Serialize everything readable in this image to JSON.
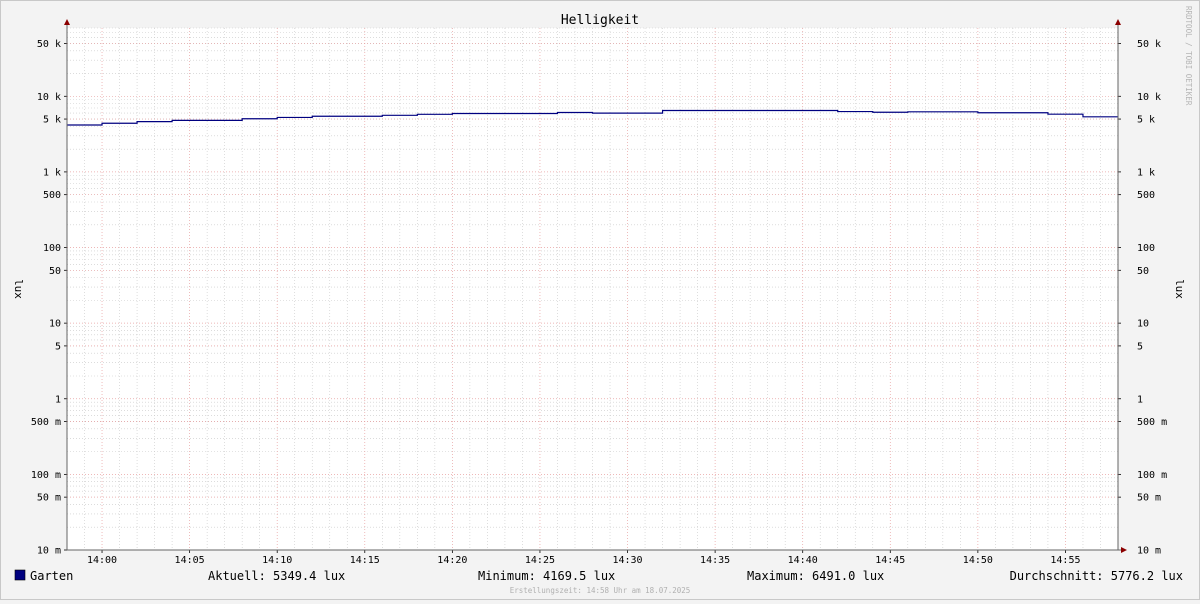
{
  "chart_data": {
    "type": "line",
    "title": "Helligkeit",
    "ylabel_left": "lux",
    "ylabel_right": "lux",
    "yscale": "log",
    "ylim": [
      0.01,
      80000
    ],
    "xlim": [
      "13:58",
      "14:58"
    ],
    "y_ticks": [
      {
        "v": 50000,
        "label": "50 k"
      },
      {
        "v": 10000,
        "label": "10 k"
      },
      {
        "v": 5000,
        "label": "5 k"
      },
      {
        "v": 1000,
        "label": "1 k"
      },
      {
        "v": 500,
        "label": "500"
      },
      {
        "v": 100,
        "label": "100"
      },
      {
        "v": 50,
        "label": "50"
      },
      {
        "v": 10,
        "label": "10"
      },
      {
        "v": 5,
        "label": "5"
      },
      {
        "v": 1,
        "label": "1"
      },
      {
        "v": 0.5,
        "label": "500 m"
      },
      {
        "v": 0.1,
        "label": "100 m"
      },
      {
        "v": 0.05,
        "label": "50 m"
      },
      {
        "v": 0.01,
        "label": "10 m"
      }
    ],
    "x_ticks": [
      "14:00",
      "14:05",
      "14:10",
      "14:15",
      "14:20",
      "14:25",
      "14:30",
      "14:35",
      "14:40",
      "14:45",
      "14:50",
      "14:55"
    ],
    "grid": true,
    "series": [
      {
        "name": "Garten",
        "color": "#000080",
        "step": true,
        "x": [
          "13:58",
          "14:00",
          "14:02",
          "14:04",
          "14:08",
          "14:10",
          "14:12",
          "14:16",
          "14:18",
          "14:20",
          "14:26",
          "14:28",
          "14:32",
          "14:42",
          "14:44",
          "14:46",
          "14:50",
          "14:54",
          "14:56",
          "14:58"
        ],
        "values": [
          4169.5,
          4400,
          4620,
          4800,
          5050,
          5250,
          5450,
          5600,
          5780,
          5920,
          6100,
          5990,
          6491,
          6280,
          6150,
          6230,
          6060,
          5800,
          5349.4,
          5349.4
        ]
      }
    ]
  },
  "legend": {
    "series_name": "Garten",
    "swatch_color": "#000080",
    "current": "Aktuell: 5349.4 lux",
    "minimum": "Minimum: 4169.5 lux",
    "maximum": "Maximum: 6491.0 lux",
    "average": "Durchschnitt: 5776.2 lux"
  },
  "footer": "Erstellungszeit: 14:58 Uhr am 18.07.2025",
  "watermark": "RRDTOOL / TOBI OETIKER",
  "colors": {
    "major_grid": "#e8a0a0",
    "minor_grid": "#c8c8c8",
    "arrow": "#8b0000",
    "plot_background": "#ffffff"
  }
}
